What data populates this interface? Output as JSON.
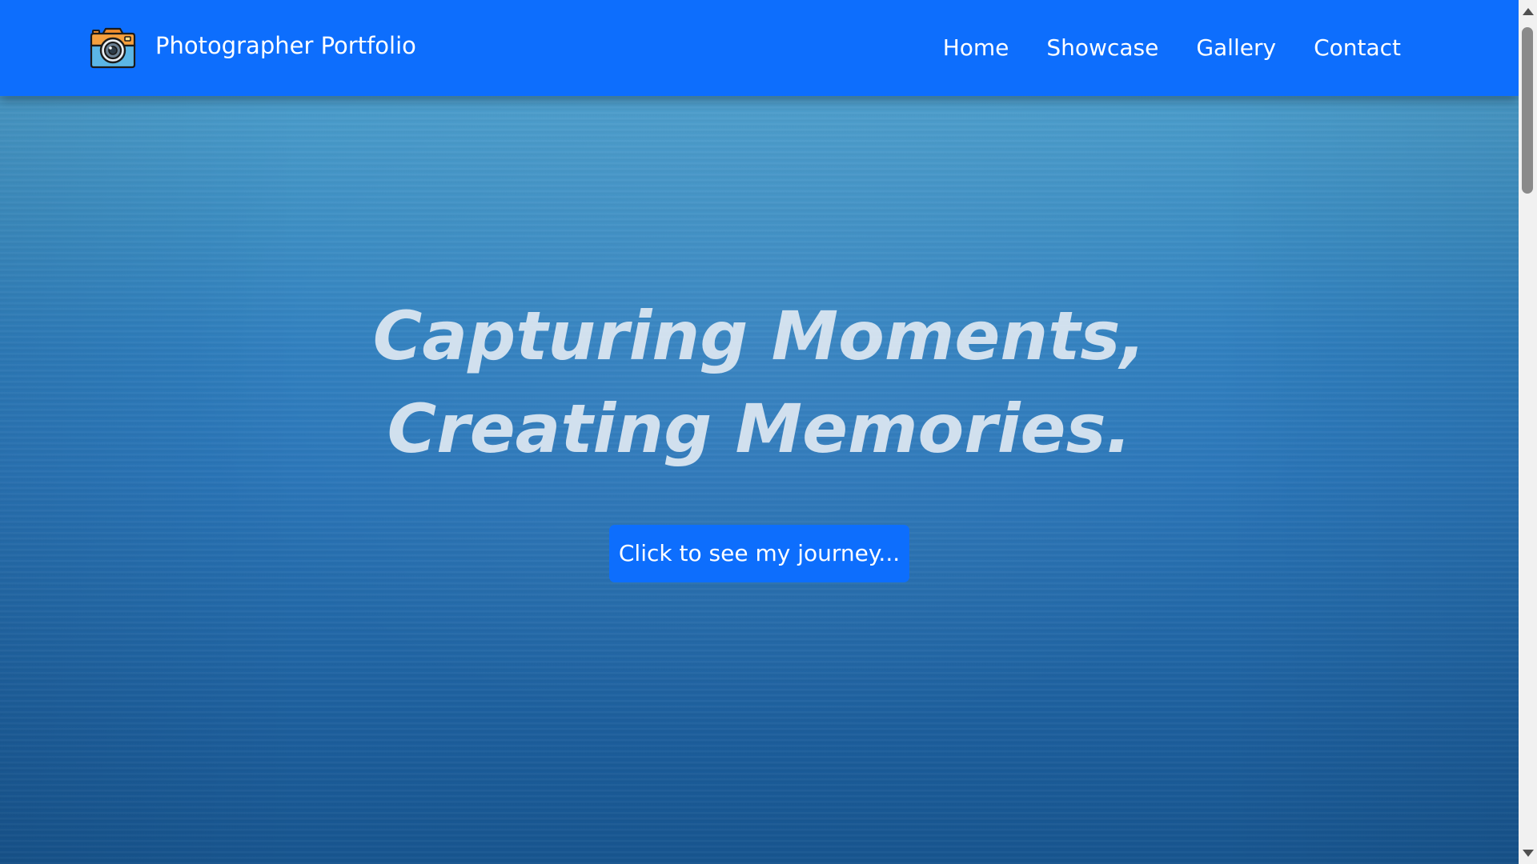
{
  "navbar": {
    "brand_name": "Photographer Portfolio",
    "brand_icon": "camera-icon",
    "background_color": "#0d6efd",
    "links": [
      {
        "label": "Home"
      },
      {
        "label": "Showcase"
      },
      {
        "label": "Gallery"
      },
      {
        "label": "Contact"
      }
    ]
  },
  "hero": {
    "title_line_1": "Capturing Moments,",
    "title_line_2": "Creating Memories.",
    "cta_label": "Click to see my journey...",
    "background": "ocean-water-photo"
  },
  "scrollbar": {
    "up_icon": "chevron-up-icon",
    "down_icon": "chevron-down-icon"
  }
}
